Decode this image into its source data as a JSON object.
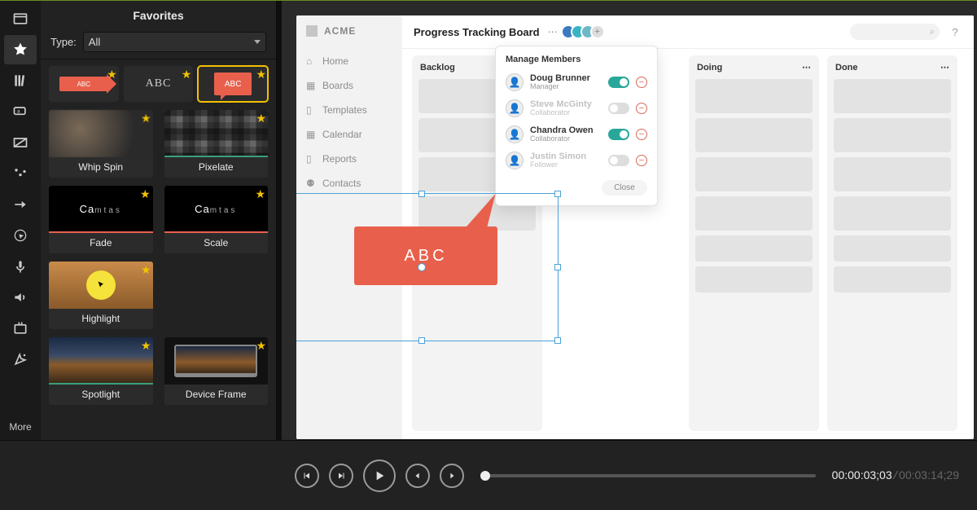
{
  "panel": {
    "title": "Favorites",
    "type_label": "Type:",
    "type_value": "All",
    "top_items": [
      {
        "name": "arrow-callout",
        "text": "ABC"
      },
      {
        "name": "text-abc",
        "text": "ABC"
      },
      {
        "name": "speech-callout",
        "text": "ABC",
        "selected": true
      }
    ],
    "cards": [
      {
        "name": "whip-spin",
        "label": "Whip Spin"
      },
      {
        "name": "pixelate",
        "label": "Pixelate"
      },
      {
        "name": "fade",
        "label": "Fade"
      },
      {
        "name": "scale",
        "label": "Scale"
      },
      {
        "name": "highlight",
        "label": "Highlight"
      },
      {
        "name": "spotlight",
        "label": "Spotlight"
      },
      {
        "name": "device-frame",
        "label": "Device Frame"
      }
    ]
  },
  "tool_rail_more": "More",
  "mock": {
    "brand": "ACME",
    "nav": [
      {
        "icon": "home",
        "label": "Home"
      },
      {
        "icon": "clipboard",
        "label": "Boards"
      },
      {
        "icon": "file",
        "label": "Templates"
      },
      {
        "icon": "calendar",
        "label": "Calendar"
      },
      {
        "icon": "file",
        "label": "Reports"
      },
      {
        "icon": "users",
        "label": "Contacts"
      }
    ],
    "board_title": "Progress Tracking Board",
    "search_icon": "⌕",
    "help": "?",
    "columns": [
      {
        "name": "Backlog"
      },
      {
        "name": "Doing"
      },
      {
        "name": "Done"
      }
    ],
    "popup": {
      "title": "Manage Members",
      "members": [
        {
          "name": "Doug Brunner",
          "role": "Manager",
          "on": true,
          "dim": false
        },
        {
          "name": "Steve McGinty",
          "role": "Collaborator",
          "on": false,
          "dim": true
        },
        {
          "name": "Chandra Owen",
          "role": "Collaborator",
          "on": true,
          "dim": false
        },
        {
          "name": "Justin Simon",
          "role": "Follower",
          "on": false,
          "dim": true
        }
      ],
      "close": "Close"
    }
  },
  "callout_text": "ABC",
  "timecode": {
    "current": "00:00:03;03",
    "total": "00:03:14;29"
  },
  "colors": {
    "accent_red": "#e8604c",
    "star": "#f2c200",
    "teal": "#2aa79b",
    "selection": "#4aa3d8"
  }
}
